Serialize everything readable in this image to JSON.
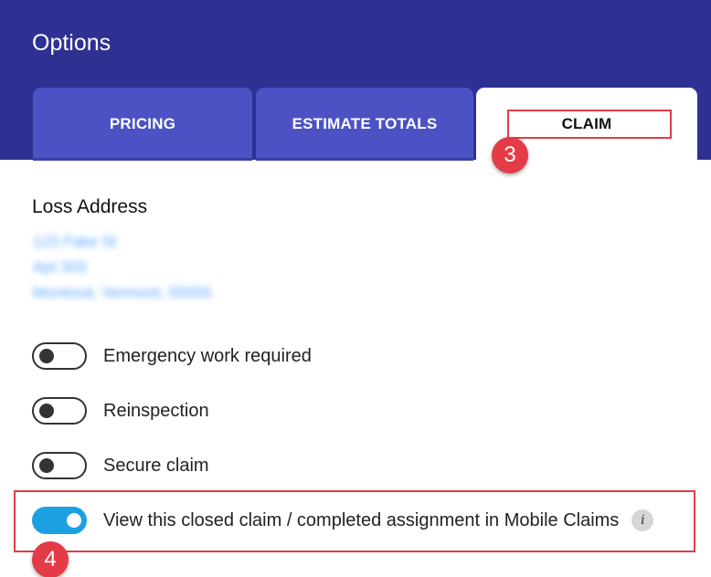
{
  "header": {
    "title": "Options"
  },
  "tabs": [
    {
      "label": "PRICING",
      "active": false
    },
    {
      "label": "ESTIMATE TOTALS",
      "active": false
    },
    {
      "label": "CLAIM",
      "active": true
    }
  ],
  "annotations": {
    "step3": "3",
    "step4": "4"
  },
  "loss_address": {
    "title": "Loss Address",
    "lines": [
      "123 Fake St",
      "Apt 303",
      "Montreal, Vermont, 55555"
    ]
  },
  "toggles": [
    {
      "label": "Emergency work required",
      "on": false
    },
    {
      "label": "Reinspection",
      "on": false
    },
    {
      "label": "Secure claim",
      "on": false
    },
    {
      "label": "View this closed claim / completed assignment in Mobile Claims",
      "on": true
    }
  ],
  "icons": {
    "info": "i"
  },
  "colors": {
    "header": "#2e3192",
    "tab_inactive": "#4c52c4",
    "toggle_on": "#1ba1e2",
    "annotation": "#e33c46"
  }
}
